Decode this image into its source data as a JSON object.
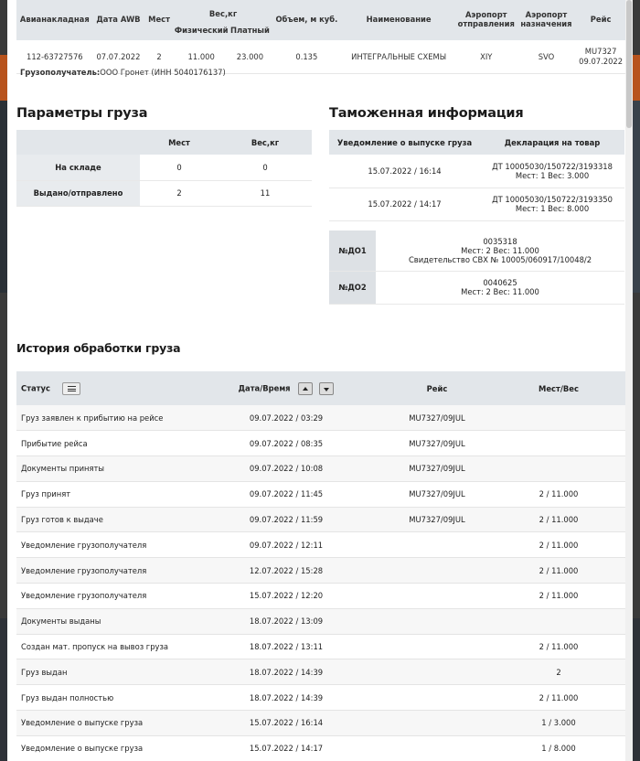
{
  "awb": {
    "headers": {
      "awb": "Авианакладная",
      "date": "Дата AWB",
      "places": "Мест",
      "weight": "Вес,кг",
      "physical": "Физический",
      "paid": "Платный",
      "volume": "Объем, м куб.",
      "name": "Наименование",
      "dep_line1": "Аэропорт",
      "dep_line2": "отправления",
      "arr_line1": "Аэропорт",
      "arr_line2": "назначения",
      "flight": "Рейс"
    },
    "row": {
      "awb": "112-63727576",
      "date": "07.07.2022",
      "places": "2",
      "physical": "11.000",
      "paid": "23.000",
      "volume": "0.135",
      "name": "ИНТЕГРАЛЬНЫЕ СХЕМЫ",
      "dep": "XIY",
      "arr": "SVO",
      "flight": "MU7327",
      "flight_date": "09.07.2022"
    },
    "consignee_label": "Грузополучатель:",
    "consignee_value": "ООО Гронет (ИНН 5040176137)"
  },
  "params": {
    "title": "Параметры груза",
    "headers": {
      "places": "Мест",
      "weight": "Вес,кг"
    },
    "rows": [
      {
        "label": "На складе",
        "places": "0",
        "weight": "0"
      },
      {
        "label": "Выдано/отправлено",
        "places": "2",
        "weight": "11"
      }
    ]
  },
  "customs": {
    "title": "Таможенная информация",
    "headers": {
      "notice": "Уведомление о выпуске груза",
      "decl": "Декларация на товар"
    },
    "rows": [
      {
        "notice": "15.07.2022 / 16:14",
        "decl1": "ДТ 10005030/150722/3193318",
        "decl2": "Мест: 1   Вес: 3.000"
      },
      {
        "notice": "15.07.2022 / 14:17",
        "decl1": "ДТ 10005030/150722/3193350",
        "decl2": "Мест: 1   Вес: 8.000"
      }
    ],
    "docs": [
      {
        "label": "№ДО1",
        "line1": "0035318",
        "line2": "Мест: 2   Вес: 11.000",
        "line3": "Свидетельство СВХ № 10005/060917/10048/2"
      },
      {
        "label": "№ДО2",
        "line1": "0040625",
        "line2": "Мест: 2   Вес: 11.000"
      }
    ]
  },
  "history": {
    "title": "История обработки груза",
    "headers": {
      "status": "Статус",
      "datetime": "Дата/Время",
      "flight": "Рейс",
      "places_weight": "Мест/Вес"
    },
    "rows": [
      {
        "status": "Груз заявлен к прибытию на рейсе",
        "datetime": "09.07.2022 / 03:29",
        "flight": "MU7327/09JUL",
        "pw": ""
      },
      {
        "status": "Прибытие рейса",
        "datetime": "09.07.2022 / 08:35",
        "flight": "MU7327/09JUL",
        "pw": ""
      },
      {
        "status": "Документы приняты",
        "datetime": "09.07.2022 / 10:08",
        "flight": "MU7327/09JUL",
        "pw": ""
      },
      {
        "status": "Груз принят",
        "datetime": "09.07.2022 / 11:45",
        "flight": "MU7327/09JUL",
        "pw": "2 / 11.000"
      },
      {
        "status": "Груз готов к выдаче",
        "datetime": "09.07.2022 / 11:59",
        "flight": "MU7327/09JUL",
        "pw": "2 / 11.000"
      },
      {
        "status": "Уведомление грузополучателя",
        "datetime": "09.07.2022 / 12:11",
        "flight": "",
        "pw": "2 / 11.000"
      },
      {
        "status": "Уведомление грузополучателя",
        "datetime": "12.07.2022 / 15:28",
        "flight": "",
        "pw": "2 / 11.000"
      },
      {
        "status": "Уведомление грузополучателя",
        "datetime": "15.07.2022 / 12:20",
        "flight": "",
        "pw": "2 / 11.000"
      },
      {
        "status": "Документы выданы",
        "datetime": "18.07.2022 / 13:09",
        "flight": "",
        "pw": ""
      },
      {
        "status": "Создан мат. пропуск на вывоз груза",
        "datetime": "18.07.2022 / 13:11",
        "flight": "",
        "pw": "2 / 11.000"
      },
      {
        "status": "Груз выдан",
        "datetime": "18.07.2022 / 14:39",
        "flight": "",
        "pw": "2"
      },
      {
        "status": "Груз выдан полностью",
        "datetime": "18.07.2022 / 14:39",
        "flight": "",
        "pw": "2 / 11.000"
      },
      {
        "status": "Уведомление о выпуске груза",
        "datetime": "15.07.2022 / 16:14",
        "flight": "",
        "pw": "1 / 3.000"
      },
      {
        "status": "Уведомление о выпуске груза",
        "datetime": "15.07.2022 / 14:17",
        "flight": "",
        "pw": "1 / 8.000"
      }
    ]
  }
}
